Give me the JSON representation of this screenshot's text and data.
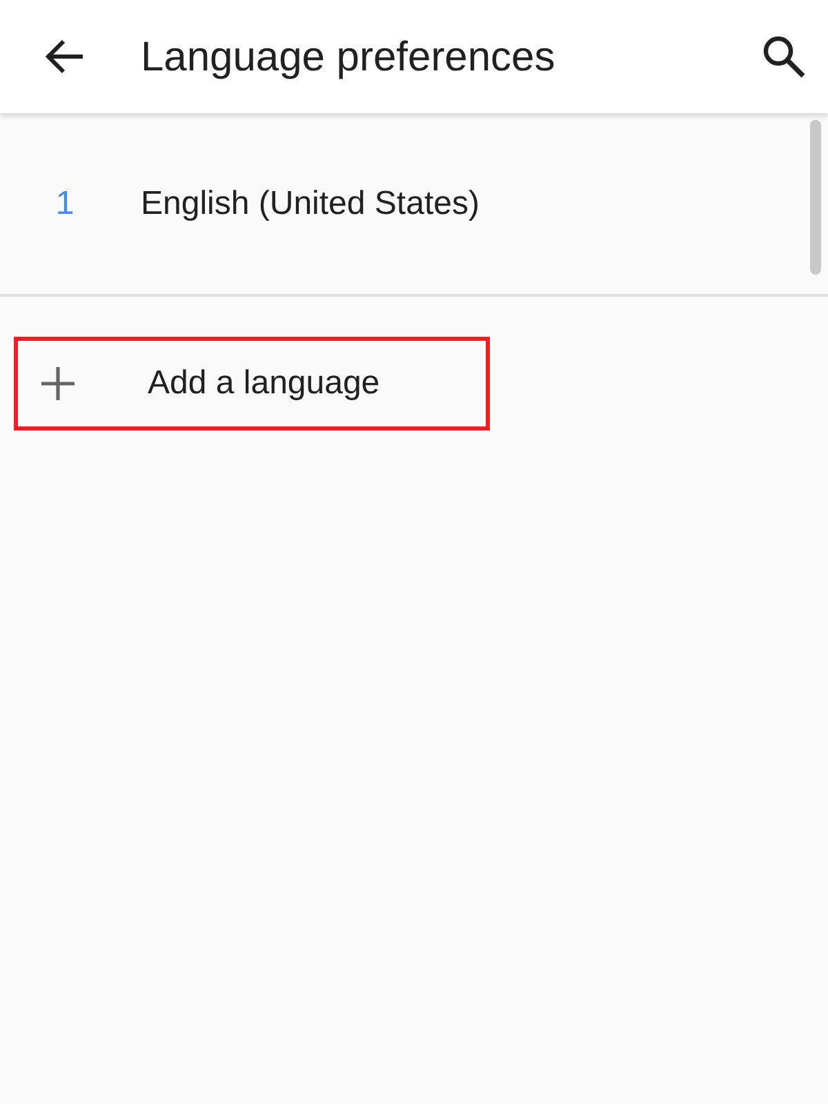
{
  "app_bar": {
    "title": "Language preferences"
  },
  "languages": [
    {
      "number": "1",
      "name": "English (United States)"
    }
  ],
  "add_action": {
    "label": "Add a language",
    "highlighted": true
  }
}
